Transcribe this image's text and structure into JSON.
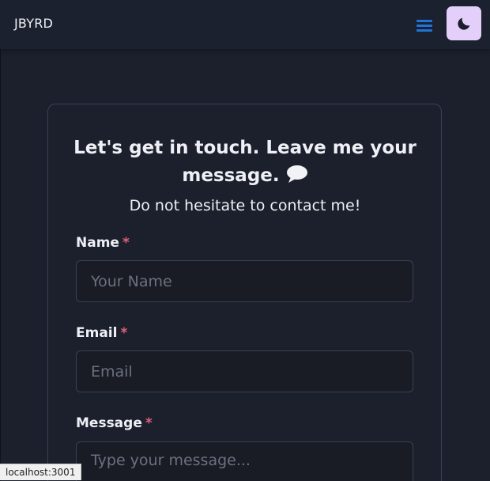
{
  "navbar": {
    "brand": "JBYRD",
    "menu_icon": "hamburger-menu-icon",
    "theme_icon": "moon-icon",
    "accent_color": "#1e74d8",
    "theme_button_color": "#e4cffb"
  },
  "contact": {
    "heading_line1": "Let's get in touch. Leave me your",
    "heading_line2": "message.",
    "heading_icon": "speech-bubble-icon",
    "subtitle": "Do not hesitate to contact me!",
    "required_marker": "*",
    "name": {
      "label": "Name",
      "placeholder": "Your Name",
      "value": ""
    },
    "email": {
      "label": "Email",
      "placeholder": "Email",
      "value": ""
    },
    "message": {
      "label": "Message",
      "placeholder": "Type your message...",
      "value": ""
    }
  },
  "status_bar": {
    "url": "localhost:3001"
  }
}
